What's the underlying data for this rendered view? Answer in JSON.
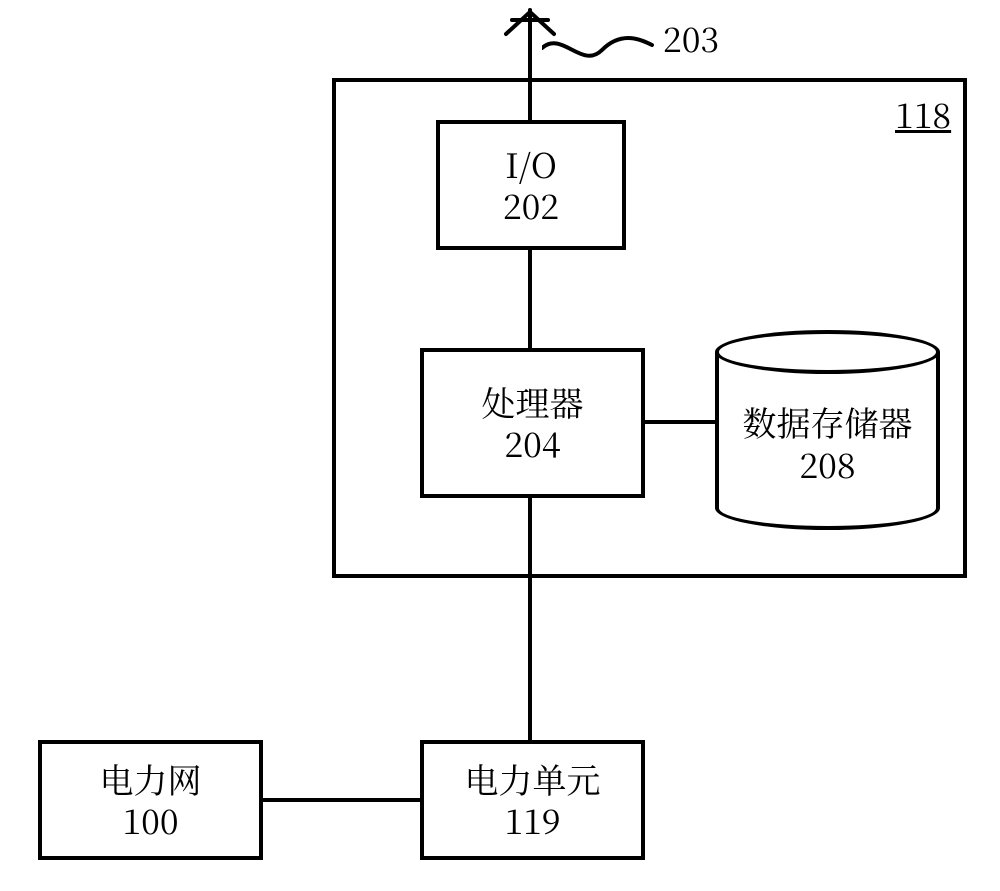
{
  "antenna_ref": "203",
  "system_ref": "118",
  "io": {
    "label": "I/O",
    "ref": "202"
  },
  "processor": {
    "label": "处理器",
    "ref": "204"
  },
  "datastore": {
    "label": "数据存储器",
    "ref": "208"
  },
  "power_unit": {
    "label": "电力单元",
    "ref": "119"
  },
  "power_grid": {
    "label": "电力网",
    "ref": "100"
  }
}
